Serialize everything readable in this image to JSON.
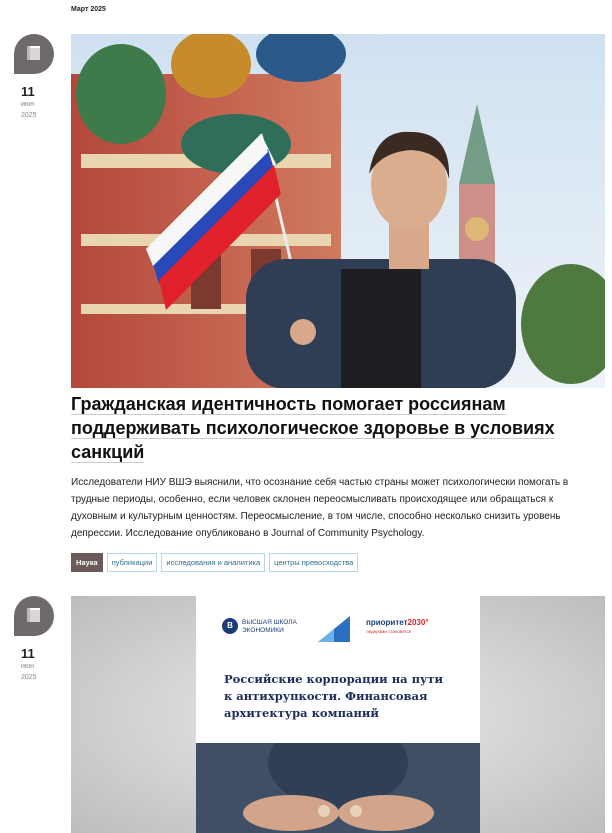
{
  "archive_label": "Март 2025",
  "items": [
    {
      "date": {
        "day": "11",
        "month": "июн",
        "year": "2025"
      },
      "headline": "Гражданская идентичность помогает россиянам поддерживать психологическое здоровье в условиях санкций",
      "lead": "Исследователи НИУ ВШЭ выяснили, что осознание себя частью страны может психологически помогать в трудные периоды, особенно, если человек склонен переосмысливать происходящее или обращаться к духовным и культурным ценностям. Переосмысление, в том числе, способно несколько снизить уровень депрессии. Исследование опубликовано в Journal of Community Psychology.",
      "tags": [
        "Наука",
        "публикации",
        "исследования и аналитика",
        "центры превосходства"
      ]
    },
    {
      "date": {
        "day": "11",
        "month": "июн",
        "year": "2025"
      },
      "cover": {
        "hse_logo_mark": "В",
        "hse_logo_text": "ВЫСШАЯ ШКОЛА ЭКОНОМИКИ",
        "priority_logo": "приоритет",
        "priority_year": "2030°",
        "priority_sub": "лидерами становятся",
        "title": "Российские корпорации на пути к антихрупкости. Финансовая архитектура компаний"
      }
    }
  ],
  "colors": {
    "icon_bg": "#6f6a6a",
    "tag_primary_bg": "#6b5a5a",
    "tag_border": "#b7d7e3",
    "tag_text": "#2f6f8f",
    "cover_title": "#1d2e5e"
  },
  "icons": {
    "date_icon": "book-bubble-icon"
  }
}
